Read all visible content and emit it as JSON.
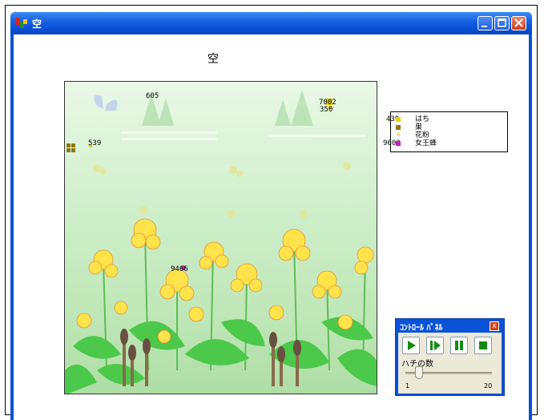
{
  "window": {
    "title": "空"
  },
  "main": {
    "heading": "空"
  },
  "field_numbers": [
    {
      "text": "605"
    },
    {
      "text": "7002"
    },
    {
      "text": "350"
    },
    {
      "text": "539"
    },
    {
      "text": "9466"
    }
  ],
  "legend": {
    "items": [
      {
        "count": "439",
        "label": "はち",
        "color": "#e6d200"
      },
      {
        "count": "",
        "label": "巣",
        "color": "#8c7a10"
      },
      {
        "count": "",
        "label": "花粉",
        "color": "#e8b400"
      },
      {
        "count": "9608",
        "label": "女王蜂",
        "color": "#d01ad0"
      }
    ]
  },
  "control_panel": {
    "title": "ｺﾝﾄﾛｰﾙ ﾊﾟﾈﾙ",
    "close_label": "x",
    "buttons": [
      {
        "name": "play-icon"
      },
      {
        "name": "step-icon"
      },
      {
        "name": "pause-icon"
      },
      {
        "name": "stop-icon"
      }
    ],
    "slider_label": "ハチの数",
    "slider_min": "1",
    "slider_max": "20",
    "slider_value": 4
  },
  "colors": {
    "titlebar": "#0a52d8",
    "flower_yellow": "#ffe34a",
    "petal_x": "#e0752a",
    "leaf_green": "#4cc84a",
    "icon_green": "#128c12"
  }
}
